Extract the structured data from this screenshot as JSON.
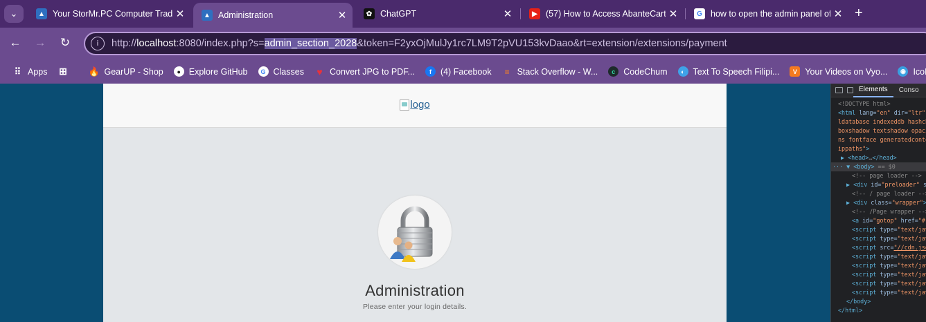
{
  "tabs": [
    {
      "title": "Your StorMr.PC Computer Trading",
      "active": false
    },
    {
      "title": "Administration",
      "active": true
    },
    {
      "title": "ChatGPT",
      "active": false
    },
    {
      "title": "(57) How to Access AbanteCart",
      "active": false
    },
    {
      "title": "how to open the admin panel of",
      "active": false
    }
  ],
  "address": {
    "scheme": "http://",
    "host": "localhost",
    "port_path": ":8080/index.php?s=",
    "selected": "admin_section_2028",
    "rest": "&token=F2yxOjMulJy1rc7LM9T2pVU153kvDaao&rt=extension/extensions/payment"
  },
  "bookmarks": [
    {
      "label": "Apps",
      "icon": "apps-grid-icon"
    },
    {
      "label": "GearUP - Shop",
      "icon": "gearup-icon"
    },
    {
      "label": "Explore GitHub",
      "icon": "github-icon"
    },
    {
      "label": "Classes",
      "icon": "google-icon"
    },
    {
      "label": "Convert JPG to PDF...",
      "icon": "heart-icon"
    },
    {
      "label": "(4) Facebook",
      "icon": "facebook-icon"
    },
    {
      "label": "Stack Overflow - W...",
      "icon": "stackoverflow-icon"
    },
    {
      "label": "CodeChum",
      "icon": "codechum-icon"
    },
    {
      "label": "Text To Speech Filipi...",
      "icon": "tts-icon"
    },
    {
      "label": "Your Videos on Vyo...",
      "icon": "vyond-icon"
    },
    {
      "label": "IcoMoon A",
      "icon": "icomoon-icon"
    }
  ],
  "page": {
    "logo_alt": "logo",
    "title": "Administration",
    "subtitle": "Please enter your login details."
  },
  "devtools": {
    "tabs": [
      "Elements",
      "Conso"
    ],
    "lines": {
      "l1": "<!DOCTYPE html>",
      "l2a": "<html ",
      "l2b": "lang=",
      "l2c": "\"en\" ",
      "l2d": "dir=",
      "l2e": "\"ltr\"",
      "l3": "ldatabase indexeddb hashch",
      "l4": "boxshadow textshadow opaci",
      "l5": "ns fontface generatedconte",
      "l6a": "ippaths\"",
      "l6b": ">",
      "l7a": "▶ <head>",
      "l7b": "…",
      "l7c": "</head>",
      "l8a": "··· ▼ <body>",
      "l8b": " == $0",
      "l9": "<!-- page loader -->",
      "l10a": "▶ <div ",
      "l10b": "id=",
      "l10c": "\"preloader\" ",
      "l10d": "st",
      "l11": "<!-- / page loader -->",
      "l12a": "▶ <div ",
      "l12b": "class=",
      "l12c": "\"wrapper\"",
      "l12d": ">",
      "l13": "<!-- /Page wrapper -->",
      "l14a": "<a ",
      "l14b": "id=",
      "l14c": "\"gotop\" ",
      "l14d": "href=",
      "l14e": "\"#\"",
      "l15a": "<script ",
      "l15b": "type=",
      "l15c": "\"text/jav",
      "l17b": "src=",
      "l17c": "\"//cdn.jsd",
      "l23": "</body>",
      "l24": "</html>"
    }
  }
}
